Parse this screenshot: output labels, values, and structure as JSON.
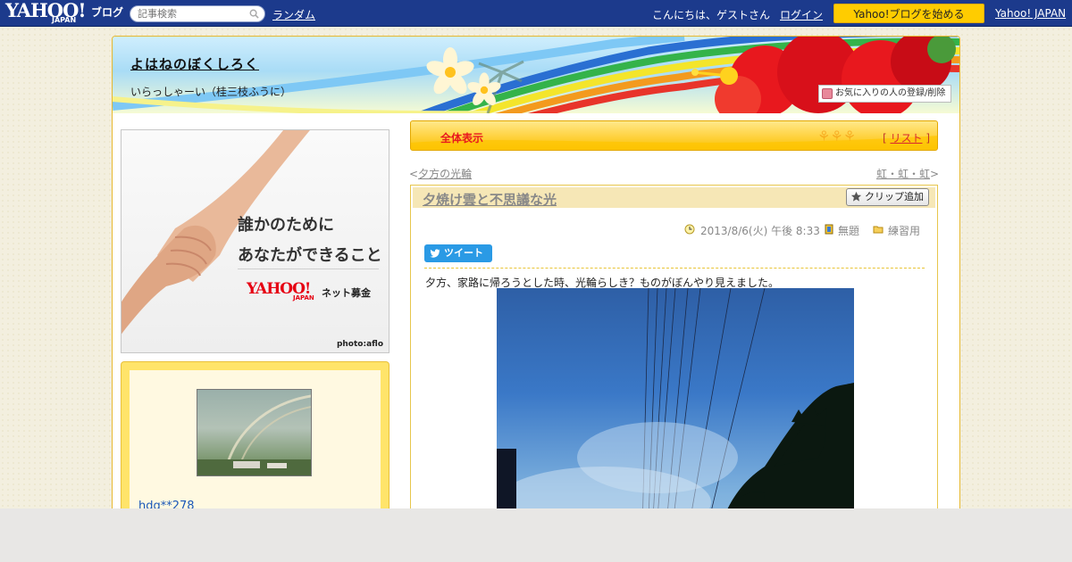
{
  "topbar": {
    "logo_word": "YAHOO!",
    "logo_sub": "JAPAN",
    "logo_service": "ブログ",
    "search_placeholder": "記事検索",
    "random_label": "ランダム",
    "greeting": "こんにちは、ゲストさん",
    "login_label": "ログイン",
    "start_blog_label": "Yahoo!ブログを始める",
    "yahoo_japan_label": "Yahoo! JAPAN"
  },
  "header": {
    "blog_title": "よはねのぼくしろく",
    "blog_subtitle": "いらっしゃーい（桂三枝ふうに）",
    "favorite_button": "お気に入りの人の登録/削除"
  },
  "sidebar": {
    "ad": {
      "line1": "誰かのために",
      "line2": "あなたができること",
      "brand": "YAHOO!",
      "brand_sub": "JAPAN",
      "service": "ネット募金",
      "credit": "photo:aflo"
    },
    "profile": {
      "name": "hdg**278"
    }
  },
  "category_bar": {
    "label": "全体表示",
    "list_open": "[",
    "list_label": "リスト",
    "list_close": "]"
  },
  "nav": {
    "prev_prefix": "<",
    "prev_title": "夕方の光輪",
    "next_title": "虹・虹・虹",
    "next_suffix": ">"
  },
  "article": {
    "title": "夕焼け雲と不思議な光",
    "clip_button": "クリップ追加",
    "date": "2013/8/6(火) 午後 8:33",
    "theme": "無題",
    "category": "練習用",
    "tweet_label": "ツイート",
    "body": "夕方、家路に帰ろうとした時、光輪らしき？ものがぼんやり見えました。"
  },
  "colors": {
    "topbar": "#1c3a8c",
    "accent_yellow": "#ffcc00",
    "category_red": "#e8181e",
    "link_blue": "#1a57b8"
  }
}
